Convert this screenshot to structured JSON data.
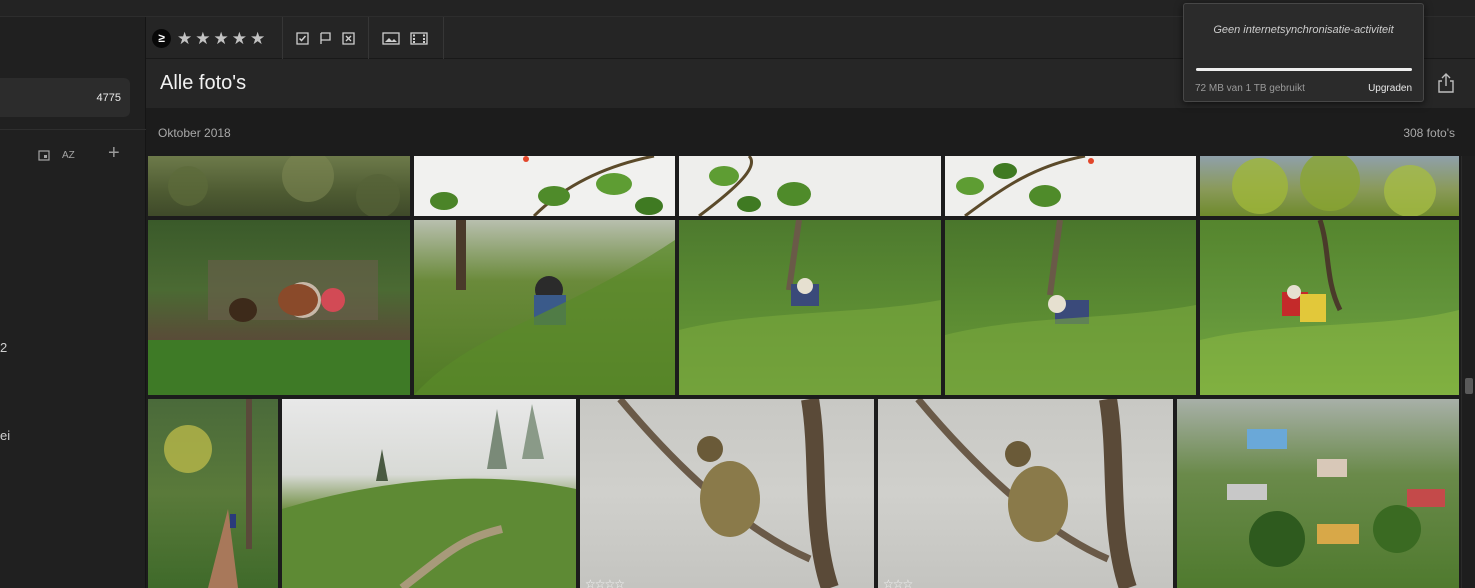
{
  "sidebar": {
    "selected_count": "4775",
    "sort_label": "AZ",
    "fragment_1": "2",
    "fragment_2": "ei"
  },
  "filterbar": {
    "ge_symbol": "≥",
    "rating_filter": "0",
    "stars": [
      "★",
      "★",
      "★",
      "★",
      "★"
    ]
  },
  "header": {
    "title": "Alle foto's"
  },
  "date_group": {
    "date": "Oktober 2018",
    "count": "308 foto's"
  },
  "sync": {
    "message": "Geen internetsynchronisatie-activiteit",
    "usage": "72 MB van 1 TB gebruikt",
    "upgrade_label": "Upgraden",
    "progress": 1.0
  },
  "photos": [
    {
      "id": "r0c0",
      "subject": "hillside"
    },
    {
      "id": "r0c1",
      "subject": "leaves"
    },
    {
      "id": "r0c2",
      "subject": "leaves"
    },
    {
      "id": "r0c3",
      "subject": "leaves"
    },
    {
      "id": "r0c4",
      "subject": "tree-canopy"
    },
    {
      "id": "r1c0",
      "subject": "chickens-garbage"
    },
    {
      "id": "r1c1",
      "subject": "tea-picker"
    },
    {
      "id": "r1c2",
      "subject": "tea-picker"
    },
    {
      "id": "r1c3",
      "subject": "tea-picker"
    },
    {
      "id": "r1c4",
      "subject": "tea-picker"
    },
    {
      "id": "r2c0",
      "subject": "forest-path"
    },
    {
      "id": "r2c1",
      "subject": "misty-tea-field"
    },
    {
      "id": "r2c2",
      "subject": "bird-on-branch",
      "stars": "☆☆☆☆"
    },
    {
      "id": "r2c3",
      "subject": "bird-on-branch",
      "stars": "☆☆☆"
    },
    {
      "id": "r2c4",
      "subject": "hill-village"
    }
  ],
  "colors": {
    "background": "#1e1e1e",
    "panel": "#252525",
    "accent_text": "#f2f2f2"
  }
}
